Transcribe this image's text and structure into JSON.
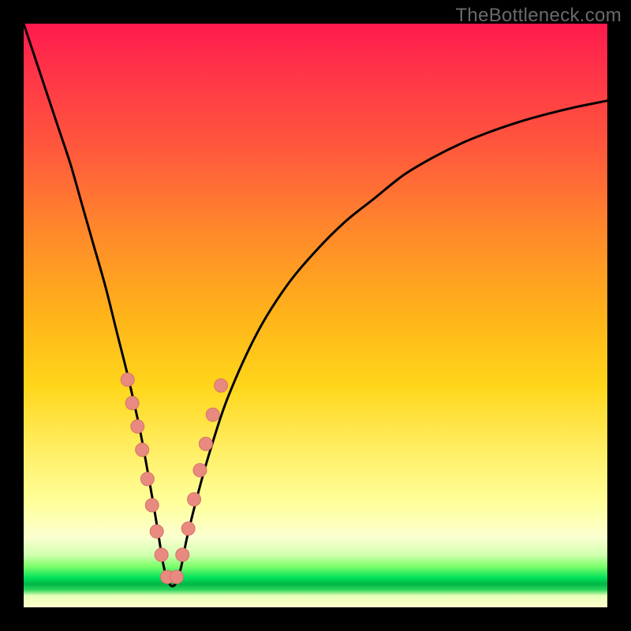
{
  "watermark": "TheBottleneck.com",
  "colors": {
    "curve_stroke": "#000000",
    "marker_fill": "#e88a80",
    "marker_stroke": "#d87468"
  },
  "chart_data": {
    "type": "line",
    "title": "",
    "xlabel": "",
    "ylabel": "",
    "xlim": [
      0,
      100
    ],
    "ylim": [
      0,
      100
    ],
    "notch_x": 25,
    "series": [
      {
        "name": "bottleneck-curve",
        "x": [
          0,
          2,
          4,
          6,
          8,
          10,
          12,
          14,
          16,
          18,
          20,
          22,
          23,
          24,
          25,
          26,
          27,
          28,
          30,
          32,
          35,
          40,
          45,
          50,
          55,
          60,
          65,
          70,
          75,
          80,
          85,
          90,
          95,
          100
        ],
        "y": [
          100,
          94,
          88,
          82,
          76,
          69,
          62,
          55,
          47,
          39,
          30,
          19,
          13,
          7,
          4,
          4,
          7,
          12,
          20,
          27,
          36,
          47,
          55,
          61,
          66,
          70,
          74,
          77,
          79.5,
          81.5,
          83.2,
          84.6,
          85.8,
          86.8
        ]
      }
    ],
    "markers": {
      "name": "highlight-beads",
      "x": [
        17.8,
        18.6,
        19.5,
        20.3,
        21.2,
        22.0,
        22.8,
        23.6,
        24.6,
        26.2,
        27.2,
        28.2,
        29.2,
        30.2,
        31.2,
        32.4,
        33.8
      ],
      "y": [
        39.0,
        35.0,
        31.0,
        27.0,
        22.0,
        17.5,
        13.0,
        9.0,
        5.2,
        5.2,
        9.0,
        13.5,
        18.5,
        23.5,
        28.0,
        33.0,
        38.0
      ]
    }
  }
}
